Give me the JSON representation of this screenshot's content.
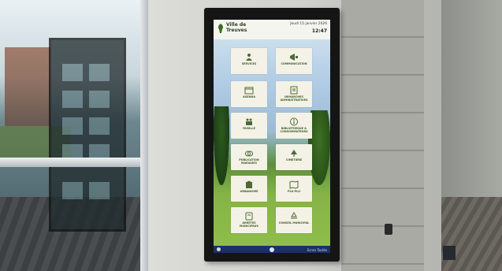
{
  "kiosk": {
    "town_name": "Ville de Treuves",
    "date": "Jeudi 15 janvier 2026",
    "time": "12:47",
    "footer_text": "Ecran Tactile",
    "tiles": [
      {
        "label": "Services",
        "icon": "people-icon"
      },
      {
        "label": "Communication",
        "icon": "megaphone-icon"
      },
      {
        "label": "Agenda",
        "icon": "calendar-icon"
      },
      {
        "label": "Demarches administratives",
        "icon": "document-icon"
      },
      {
        "label": "Famille",
        "icon": "family-icon"
      },
      {
        "label": "Bibliotheque & consommateurs",
        "icon": "info-icon"
      },
      {
        "label": "Publication mariages",
        "icon": "rings-icon"
      },
      {
        "label": "Cimetiere",
        "icon": "tree-icon"
      },
      {
        "label": "Urbanisme",
        "icon": "building-icon"
      },
      {
        "label": "Plu-Plu",
        "icon": "map-icon"
      },
      {
        "label": "Arretes municipaux",
        "icon": "scroll-icon"
      },
      {
        "label": "Conseil municipal",
        "icon": "recycle-icon"
      }
    ]
  }
}
